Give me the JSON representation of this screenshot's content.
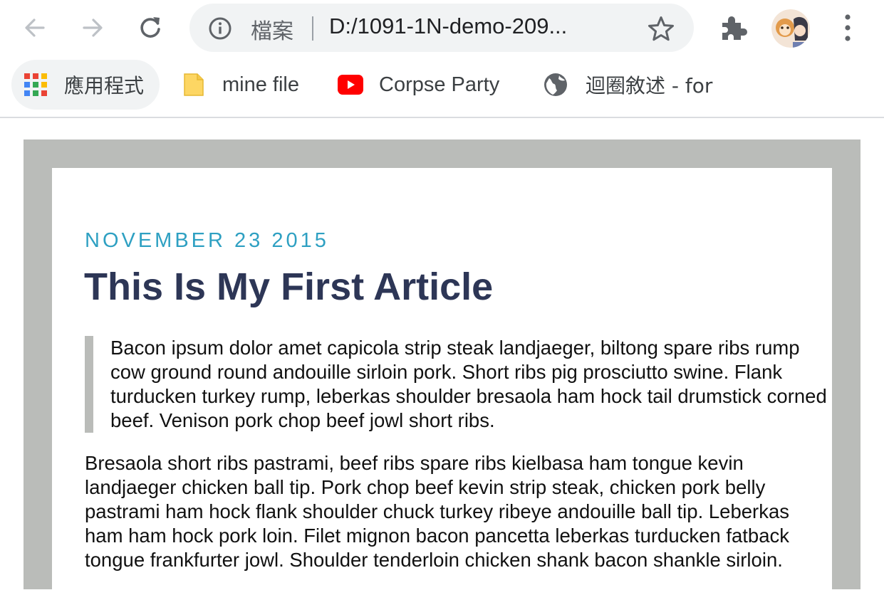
{
  "browser": {
    "omnibox": {
      "scheme_label": "檔案",
      "url": "D:/1091-1N-demo-209..."
    },
    "bookmarks": [
      {
        "label": "應用程式",
        "icon": "apps-grid-icon"
      },
      {
        "label": "mine file",
        "icon": "folder-icon"
      },
      {
        "label": "Corpse Party",
        "icon": "youtube-icon"
      },
      {
        "label": "迴圈敘述 - for",
        "icon": "globe-icon"
      }
    ],
    "colors": {
      "youtube_red": "#ff0000",
      "folder_yellow": "#fdd663"
    }
  },
  "article": {
    "date": "NOVEMBER 23 2015",
    "title": "This Is My First Article",
    "quote": "Bacon ipsum dolor amet capicola strip steak landjaeger, biltong spare ribs rump cow ground round andouille sirloin pork. Short ribs pig prosciutto swine. Flank turducken turkey rump, leberkas shoulder bresaola ham hock tail drumstick corned beef. Venison pork chop beef jowl short ribs.",
    "body": "Bresaola short ribs pastrami, beef ribs spare ribs kielbasa ham tongue kevin landjaeger chicken ball tip. Pork chop beef kevin strip steak, chicken pork belly pastrami ham hock flank shoulder chuck turkey ribeye andouille ball tip. Leberkas ham ham hock pork loin. Filet mignon bacon pancetta leberkas turducken fatback tongue frankfurter jowl. Shoulder tenderloin chicken shank bacon shankle sirloin.",
    "colors": {
      "date": "#2ea0c2",
      "title": "#2d3656",
      "frame": "#babcb9"
    }
  }
}
